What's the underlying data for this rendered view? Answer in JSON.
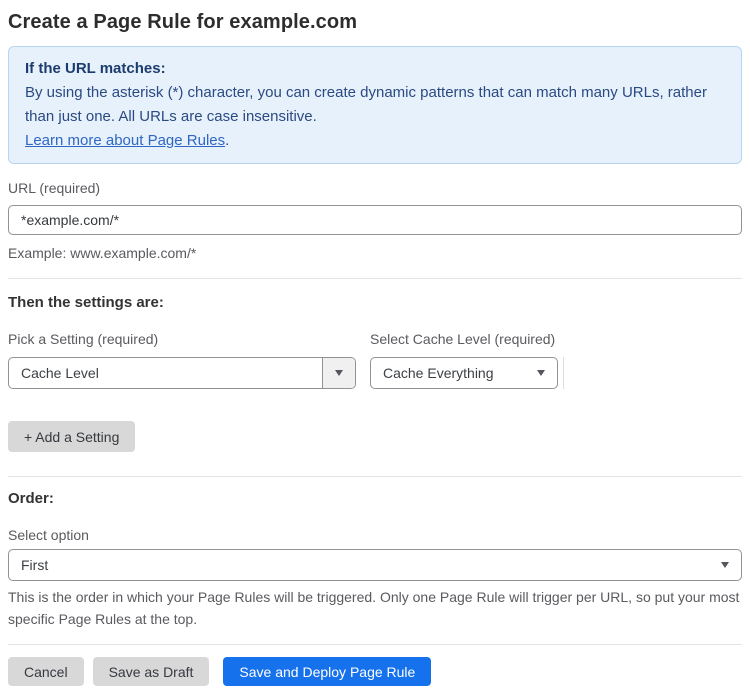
{
  "page": {
    "title": "Create a Page Rule for example.com"
  },
  "info_box": {
    "heading": "If the URL matches:",
    "body": "By using the asterisk (*) character, you can create dynamic patterns that can match many URLs, rather than just one. All URLs are case insensitive.",
    "link_label": "Learn more about Page Rules",
    "link_suffix": "."
  },
  "url_field": {
    "label": "URL (required)",
    "value": "*example.com/*",
    "help": "Example: www.example.com/*"
  },
  "settings_section": {
    "heading": "Then the settings are:",
    "setting_picker": {
      "label": "Pick a Setting (required)",
      "value": "Cache Level"
    },
    "cache_level_picker": {
      "label": "Select Cache Level (required)",
      "value": "Cache Everything"
    },
    "add_setting_label": "+ Add a Setting"
  },
  "order_section": {
    "heading": "Order:",
    "label": "Select option",
    "value": "First",
    "help": "This is the order in which your Page Rules will be triggered. Only one Page Rule will trigger per URL, so put your most specific Page Rules at the top."
  },
  "actions": {
    "cancel_label": "Cancel",
    "save_draft_label": "Save as Draft",
    "save_deploy_label": "Save and Deploy Page Rule"
  },
  "icons": {
    "dropdown_arrow": "caret-down-icon"
  },
  "colors": {
    "accent_blue": "#1671ec",
    "info_bg": "#e7f1fb",
    "info_border": "#b7d5f1",
    "info_heading_text": "#1d3c6e",
    "info_body_text": "#2a4a82",
    "link_blue": "#2f66c4",
    "button_gray": "#d8d8d8",
    "input_border": "#919196"
  }
}
